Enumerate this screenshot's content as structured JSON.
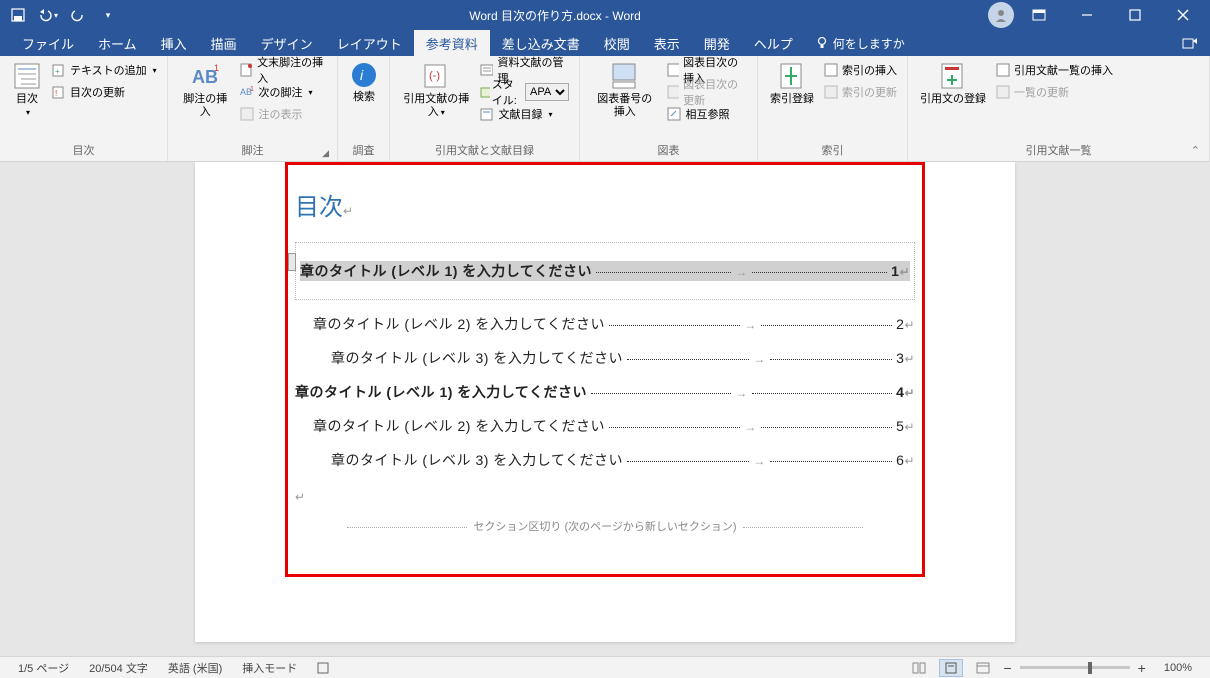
{
  "titlebar": {
    "doc_title": "Word 目次の作り方.docx - Word"
  },
  "tabs": {
    "file": "ファイル",
    "home": "ホーム",
    "insert": "挿入",
    "draw": "描画",
    "design": "デザイン",
    "layout": "レイアウト",
    "references": "参考資料",
    "mailings": "差し込み文書",
    "review": "校閲",
    "view": "表示",
    "developer": "開発",
    "help": "ヘルプ",
    "tell_me": "何をしますか"
  },
  "ribbon": {
    "toc_group": "目次",
    "toc_btn": "目次",
    "add_text": "テキストの追加",
    "update_toc": "目次の更新",
    "footnote_group": "脚注",
    "insert_footnote": "脚注の挿入",
    "insert_endnote": "文末脚注の挿入",
    "next_footnote": "次の脚注",
    "show_notes": "注の表示",
    "research_group": "調査",
    "search": "検索",
    "citation_group": "引用文献と文献目録",
    "insert_citation": "引用文献の挿入",
    "manage_sources": "資料文献の管理",
    "style_label": "スタイル:",
    "style_value": "APA",
    "bibliography": "文献目録",
    "captions_group": "図表",
    "insert_caption": "図表番号の挿入",
    "insert_tof": "図表目次の挿入",
    "update_tof": "図表目次の更新",
    "cross_ref": "相互参照",
    "index_group": "索引",
    "mark_entry": "索引登録",
    "insert_index": "索引の挿入",
    "update_index": "索引の更新",
    "toa_group": "引用文献一覧",
    "mark_citation": "引用文の登録",
    "insert_toa": "引用文献一覧の挿入",
    "update_toa": "一覧の更新"
  },
  "document": {
    "toc_heading": "目次",
    "entries": [
      {
        "level": 1,
        "text": "章のタイトル (レベル 1) を入力してください",
        "page": "1",
        "selected": true
      },
      {
        "level": 2,
        "text": "章のタイトル (レベル 2) を入力してください",
        "page": "2"
      },
      {
        "level": 3,
        "text": "章のタイトル (レベル 3) を入力してください",
        "page": "3"
      },
      {
        "level": 1,
        "text": "章のタイトル (レベル 1) を入力してください",
        "page": "4"
      },
      {
        "level": 2,
        "text": "章のタイトル (レベル 2) を入力してください",
        "page": "5"
      },
      {
        "level": 3,
        "text": "章のタイトル (レベル 3) を入力してください",
        "page": "6"
      }
    ],
    "section_break": "セクション区切り (次のページから新しいセクション)"
  },
  "status": {
    "page": "1/5 ページ",
    "words": "20/504 文字",
    "language": "英語 (米国)",
    "mode": "挿入モード",
    "zoom": "100%"
  }
}
